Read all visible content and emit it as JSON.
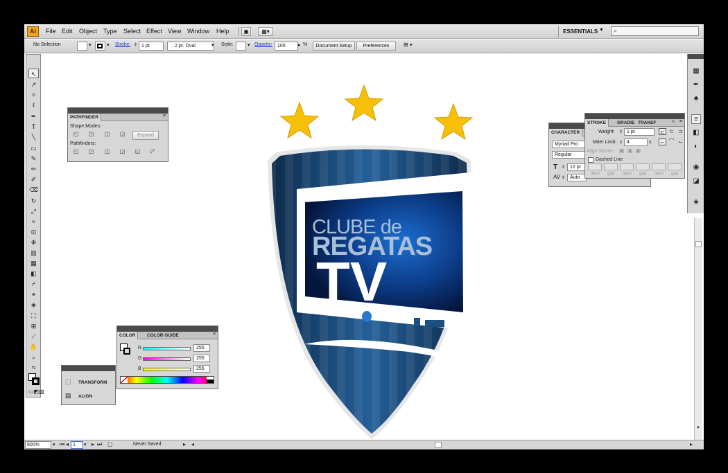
{
  "menubar": {
    "app_icon": "Ai",
    "items": [
      "File",
      "Edit",
      "Object",
      "Type",
      "Select",
      "Effect",
      "View",
      "Window",
      "Help"
    ],
    "workspace": "ESSENTIALS",
    "search_placeholder": ""
  },
  "control": {
    "selection": "No Selection",
    "stroke_label": "Stroke:",
    "stroke_value": "1 pt",
    "brush": "2 pt. Oval",
    "style_label": "Style:",
    "opacity_label": "Opacity:",
    "opacity_value": "100",
    "opacity_unit": "%",
    "document_setup": "Document Setup",
    "preferences": "Preferences"
  },
  "pathfinder": {
    "title": "PATHFINDER",
    "shape_modes": "Shape Modes:",
    "expand": "Expand",
    "pathfinders": "Pathfinders:"
  },
  "color_panel": {
    "tabs": [
      "COLOR",
      "COLOR GUIDE"
    ],
    "channels": [
      {
        "label": "R",
        "value": "255",
        "color": "#d03030"
      },
      {
        "label": "G",
        "value": "255",
        "color": "#20a020"
      },
      {
        "label": "B",
        "value": "255",
        "color": "#2040d0"
      }
    ]
  },
  "mini_panel": {
    "items": [
      "TRANSFORM",
      "ALIGN"
    ]
  },
  "character": {
    "title": "CHARACTER",
    "font": "Myriad Pro",
    "style": "Regular",
    "size": "12 pt",
    "tracking": "Auto"
  },
  "stroke_panel": {
    "tabs": [
      "STROKE",
      "GRADIE",
      "TRANSF"
    ],
    "weight_label": "Weight:",
    "weight_value": "1 pt",
    "miter_label": "Miter Limit:",
    "miter_value": "4",
    "miter_unit": "x",
    "align_label": "Align Stroke:",
    "dashed_label": "Dashed Line",
    "dash_labels": [
      "dash",
      "gap",
      "dash",
      "gap",
      "dash",
      "gap"
    ]
  },
  "status": {
    "zoom": "800%",
    "page": "1",
    "state": "Never Saved"
  },
  "artwork": {
    "line1": "CLUBE de",
    "line2": "REGATAS",
    "line3": "TV",
    "star_color": "#f6c008",
    "shield_color": "#1a4f82"
  },
  "colors": {
    "canvas": "#ffffff",
    "chrome": "#d6d6d6",
    "panel_head": "#4a4a4a"
  }
}
